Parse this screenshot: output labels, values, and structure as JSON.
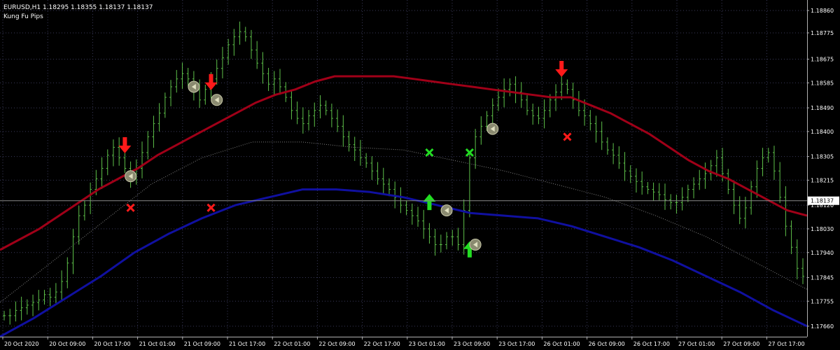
{
  "header": {
    "symbol_line": "EURUSD,H1  1.18295 1.18355 1.18137 1.18137",
    "indicator_name": "Kung Fu Pips"
  },
  "current_price": "1.18137",
  "price_labels": [
    "1.18860",
    "1.18775",
    "1.18675",
    "1.18585",
    "1.18490",
    "1.18400",
    "1.18305",
    "1.18215",
    "1.18120",
    "1.18030",
    "1.17940",
    "1.17845",
    "1.17755",
    "1.17660"
  ],
  "time_labels": [
    "20 Oct 2020",
    "20 Oct 09:00",
    "20 Oct 17:00",
    "21 Oct 01:00",
    "21 Oct 09:00",
    "21 Oct 17:00",
    "22 Oct 01:00",
    "22 Oct 09:00",
    "22 Oct 17:00",
    "23 Oct 01:00",
    "23 Oct 09:00",
    "23 Oct 17:00",
    "26 Oct 01:00",
    "26 Oct 09:00",
    "26 Oct 17:00",
    "27 Oct 01:00",
    "27 Oct 09:00",
    "27 Oct 17:00"
  ],
  "chart_data": {
    "type": "line",
    "symbol": "EURUSD",
    "timeframe": "H1",
    "ohlc_last": {
      "open": 1.18295,
      "high": 1.18355,
      "low": 1.18137,
      "close": 1.18137
    },
    "ylim": [
      1.1762,
      1.189
    ],
    "closes": [
      1.177,
      1.177,
      1.1772,
      1.1773,
      1.1774,
      1.1775,
      1.1776,
      1.1778,
      1.1777,
      1.1779,
      1.1783,
      1.179,
      1.18,
      1.1808,
      1.1812,
      1.1818,
      1.1822,
      1.1826,
      1.1831,
      1.1834,
      1.183,
      1.1826,
      1.1822,
      1.1826,
      1.1832,
      1.1838,
      1.1843,
      1.1847,
      1.1853,
      1.1857,
      1.186,
      1.1862,
      1.186,
      1.1856,
      1.1852,
      1.1856,
      1.186,
      1.1864,
      1.1868,
      1.1873,
      1.1876,
      1.1878,
      1.1876,
      1.1871,
      1.1866,
      1.1862,
      1.1858,
      1.186,
      1.1857,
      1.1853,
      1.1848,
      1.1845,
      1.1843,
      1.1846,
      1.1848,
      1.185,
      1.1848,
      1.1845,
      1.1842,
      1.1838,
      1.1835,
      1.1833,
      1.183,
      1.1828,
      1.1825,
      1.1822,
      1.182,
      1.1818,
      1.1815,
      1.1812,
      1.181,
      1.1808,
      1.1806,
      1.1803,
      1.18,
      1.1797,
      1.1797,
      1.18,
      1.18,
      1.1797,
      1.181,
      1.183,
      1.1838,
      1.1842,
      1.1846,
      1.185,
      1.1853,
      1.1856,
      1.1858,
      1.1855,
      1.1852,
      1.1848,
      1.1846,
      1.1845,
      1.1848,
      1.1852,
      1.1855,
      1.1858,
      1.1856,
      1.1852,
      1.1848,
      1.1846,
      1.1843,
      1.184,
      1.1836,
      1.1833,
      1.1831,
      1.1828,
      1.1825,
      1.1823,
      1.1821,
      1.1819,
      1.1818,
      1.1817,
      1.1816,
      1.1814,
      1.1813,
      1.1813,
      1.1815,
      1.1818,
      1.182,
      1.1822,
      1.1824,
      1.1827,
      1.183,
      1.1824,
      1.1818,
      1.1812,
      1.1807,
      1.1811,
      1.1819,
      1.1826,
      1.183,
      1.1832,
      1.1825,
      1.1815,
      1.1804,
      1.1796,
      1.1788,
      1.1785
    ],
    "upper_band": [
      1.1795,
      1.1799,
      1.1803,
      1.1808,
      1.1813,
      1.1818,
      1.1822,
      1.1826,
      1.1831,
      1.1835,
      1.1839,
      1.1843,
      1.1847,
      1.1851,
      1.1854,
      1.1856,
      1.1859,
      1.1861,
      1.1861,
      1.1861,
      1.1861,
      1.186,
      1.1859,
      1.1858,
      1.1857,
      1.1856,
      1.1855,
      1.1854,
      1.1853,
      1.1853,
      1.185,
      1.1847,
      1.1843,
      1.1839,
      1.1834,
      1.1829,
      1.1825,
      1.1822,
      1.1818,
      1.1814,
      1.181,
      1.1808
    ],
    "lower_band": [
      1.1762,
      1.1769,
      1.1777,
      1.1785,
      1.1794,
      1.1801,
      1.1807,
      1.1812,
      1.1815,
      1.1818,
      1.1818,
      1.1817,
      1.1815,
      1.1812,
      1.1809,
      1.1808,
      1.1807,
      1.1804,
      1.18,
      1.1796,
      1.1791,
      1.1785,
      1.1779,
      1.1772,
      1.1766
    ],
    "midline": [
      1.1775,
      1.179,
      1.1805,
      1.182,
      1.183,
      1.1836,
      1.1836,
      1.1834,
      1.1833,
      1.1829,
      1.1825,
      1.182,
      1.1815,
      1.1808,
      1.18,
      1.179,
      1.178
    ],
    "markers": [
      {
        "type": "sell_arrow",
        "t": 21,
        "price": 1.1832
      },
      {
        "type": "sell_arrow",
        "t": 36,
        "price": 1.1856
      },
      {
        "type": "sell_arrow",
        "t": 97,
        "price": 1.1861
      },
      {
        "type": "buy_arrow",
        "t": 74,
        "price": 1.1816
      },
      {
        "type": "buy_arrow",
        "t": 81,
        "price": 1.1798
      },
      {
        "type": "exit_cross_red",
        "t": 22,
        "price": 1.1811
      },
      {
        "type": "exit_cross_red",
        "t": 36,
        "price": 1.1811
      },
      {
        "type": "exit_cross_red",
        "t": 98,
        "price": 1.1838
      },
      {
        "type": "exit_cross_green",
        "t": 74,
        "price": 1.1832
      },
      {
        "type": "exit_cross_green",
        "t": 81,
        "price": 1.1832
      },
      {
        "type": "signal_circle",
        "t": 22,
        "price": 1.1823
      },
      {
        "type": "signal_circle",
        "t": 33,
        "price": 1.1857
      },
      {
        "type": "signal_circle",
        "t": 37,
        "price": 1.1852
      },
      {
        "type": "signal_circle",
        "t": 77,
        "price": 1.181
      },
      {
        "type": "signal_circle",
        "t": 82,
        "price": 1.1797
      },
      {
        "type": "signal_circle",
        "t": 85,
        "price": 1.1841
      }
    ],
    "colors": {
      "candles": "#5ec14a",
      "upper_band": "#a00018",
      "lower_band": "#1010a0",
      "midline": "#808080",
      "sell": "#ff1a1a",
      "buy": "#22dd22",
      "grid": "#3a3a5a",
      "axis": "#b0b0b0",
      "background": "#000000"
    }
  }
}
